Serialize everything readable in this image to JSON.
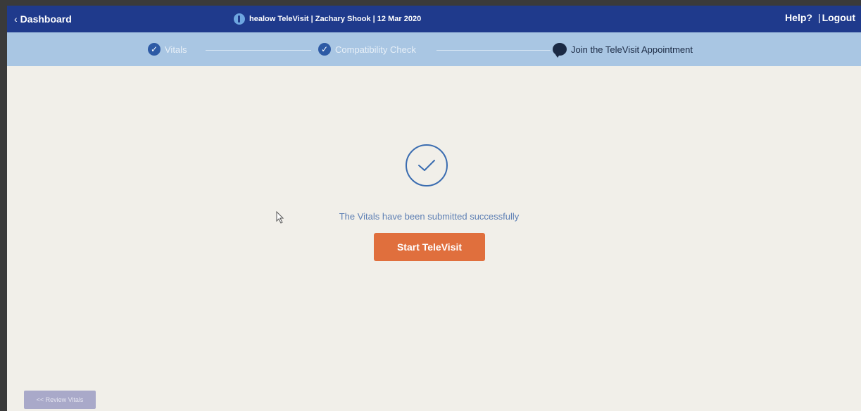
{
  "header": {
    "back_label": "Dashboard",
    "title": "healow TeleVisit | Zachary Shook | 12 Mar 2020",
    "help_label": "Help?",
    "logout_label": "Logout",
    "separator": "|"
  },
  "steps": [
    {
      "label": "Vitals",
      "status": "done",
      "icon": "check-circle-icon"
    },
    {
      "label": "Compatibility Check",
      "status": "done",
      "icon": "check-circle-icon"
    },
    {
      "label": "Join the TeleVisit Appointment",
      "status": "active",
      "icon": "chat-bubble-icon"
    }
  ],
  "main": {
    "success_message": "The Vitals have been submitted successfully",
    "start_button_label": "Start TeleVisit",
    "review_button_label": "<< Review Vitals"
  },
  "colors": {
    "topbar": "#1f3a8c",
    "stepbar": "#a9c6e3",
    "accent_button": "#e06f3d",
    "success_icon": "#3a6cb0"
  }
}
